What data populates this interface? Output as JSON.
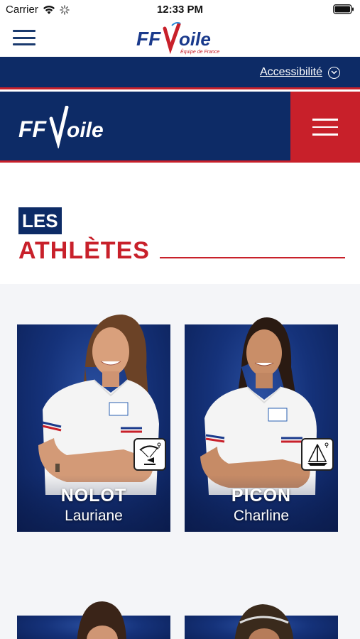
{
  "status_bar": {
    "carrier": "Carrier",
    "time": "12:33 PM"
  },
  "header": {
    "logo_text": "FFVoile",
    "logo_sub": "Équipe de France"
  },
  "access_bar": {
    "label": "Accessibilité"
  },
  "brand": {
    "logo_text": "FFVoile"
  },
  "section": {
    "tag": "LES",
    "title": "ATHLÈTES"
  },
  "athletes": [
    {
      "last_name": "NOLOT",
      "first_name": "Lauriane",
      "sport_icon": "kitefoil-icon"
    },
    {
      "last_name": "PICON",
      "first_name": "Charline",
      "sport_icon": "windsurf-icon"
    }
  ],
  "colors": {
    "navy": "#0d2b66",
    "red": "#c8202a"
  }
}
